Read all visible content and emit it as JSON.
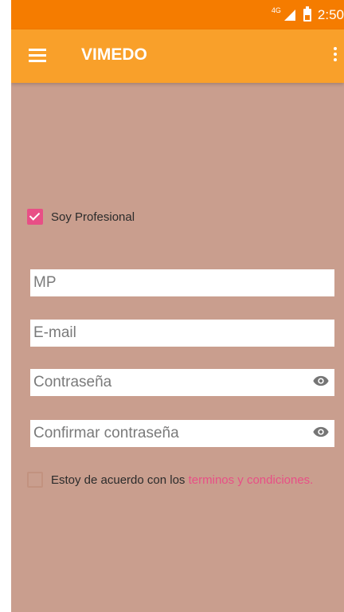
{
  "status_bar": {
    "network": "4G",
    "time": "2:50"
  },
  "toolbar": {
    "title": "VIMEDO",
    "menu_icon": "hamburger-icon",
    "overflow_icon": "more-vert-icon",
    "color": "#f9a02a"
  },
  "form": {
    "professional_checkbox": {
      "label": "Soy Profesional",
      "checked": true
    },
    "mp_placeholder": "MP",
    "email_placeholder": "E-mail",
    "password_placeholder": "Contraseña",
    "confirm_password_placeholder": "Confirmar contraseña",
    "terms_checkbox": {
      "label": "Estoy de acuerdo con los ",
      "link": "terminos y condiciones.",
      "checked": false
    }
  },
  "colors": {
    "accent": "#e84f86",
    "background": "#c99e8e",
    "status_bar": "#f57c00"
  }
}
